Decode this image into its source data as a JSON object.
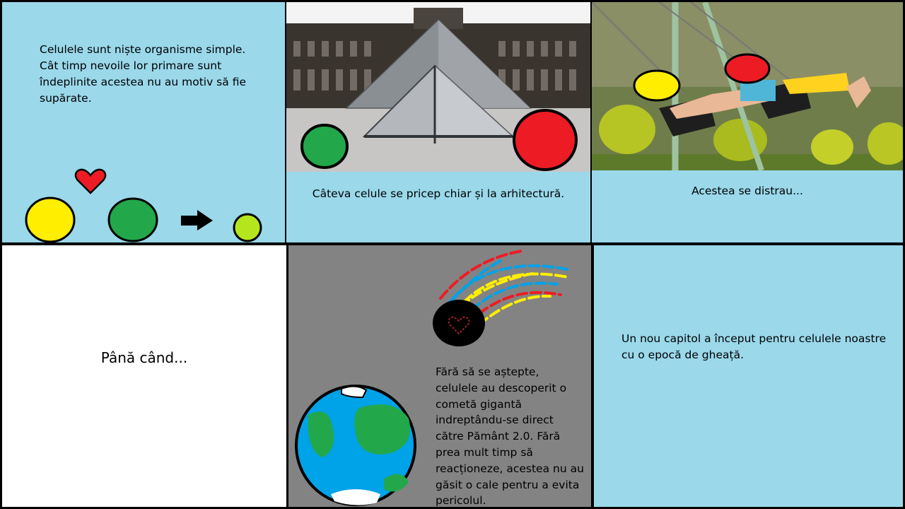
{
  "panels": {
    "p1": {
      "text": "Celulele sunt niște organisme simple. Cât timp nevoile lor primare sunt îndeplinite acestea nu au motiv să fie supărate."
    },
    "p2": {
      "caption": "Câteva celule se pricep chiar și la arhitectură."
    },
    "p3": {
      "caption": "Acestea se distrau..."
    },
    "p4": {
      "text": "Până când..."
    },
    "p5": {
      "text": "Fără să se aștepte, celulele au descoperit o cometă gigantă indreptându-se direct către Pământ 2.0. Fără prea mult timp să reacționeze, acestea nu au găsit o cale pentru a evita pericolul."
    },
    "p6": {
      "text": "Un nou capitol a început pentru celulele noastre cu o epocă de gheață."
    }
  },
  "colors": {
    "panel_blue": "#9ad8ea",
    "cell_yellow": "#ffee00",
    "cell_green": "#22a84a",
    "cell_lime": "#b5e61d",
    "cell_red": "#ed1c24",
    "comet_grey": "#838383",
    "earth_blue": "#00a2e8"
  }
}
